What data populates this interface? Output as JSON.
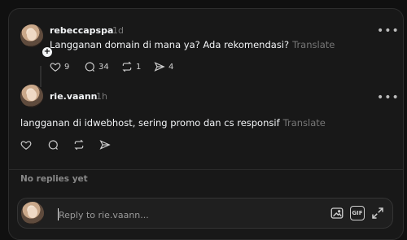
{
  "original_post": {
    "username": "rebeccapspa",
    "time": "1d",
    "text": "Langganan domain di mana ya? Ada rekomendasi?",
    "translate_label": "Translate",
    "likes": "9",
    "replies": "34",
    "reposts": "1",
    "shares": "4"
  },
  "reply_post": {
    "username": "rie.vaann",
    "time": "1h",
    "text": "langganan di idwebhost, sering promo dan cs responsif",
    "translate_label": "Translate"
  },
  "footer": {
    "no_replies": "No replies yet",
    "reply_placeholder": "Reply to rie.vaann...",
    "gif_label": "GIF"
  },
  "icons": {
    "more": "more-horizontal-icon",
    "like": "heart-icon",
    "comment": "comment-bubble-icon",
    "repost": "repost-arrows-icon",
    "share": "send-icon",
    "follow": "plus-icon",
    "image": "image-icon",
    "gif": "gif-icon",
    "expand": "expand-icon"
  },
  "colors": {
    "background": "#101010",
    "panel": "#181818",
    "text": "#f3f5f7",
    "muted": "#777777"
  }
}
